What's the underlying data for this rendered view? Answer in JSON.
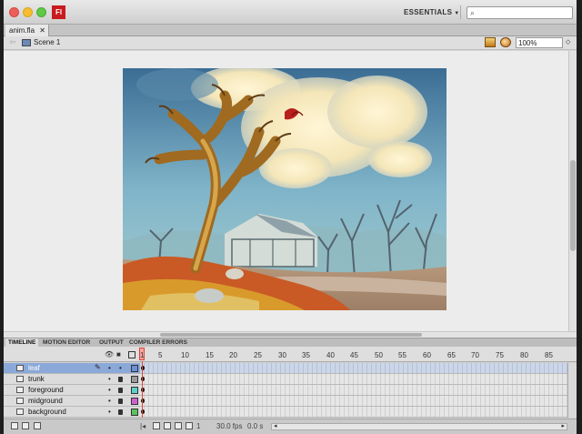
{
  "window": {
    "app_logo": "Fl",
    "workspace_label": "ESSENTIALS",
    "search_placeholder": ""
  },
  "document": {
    "tab_label": "anim.fla",
    "close_glyph": "✕",
    "scene_label": "Scene 1",
    "zoom_value": "100%"
  },
  "panel_tabs": [
    "TIMELINE",
    "MOTION EDITOR",
    "OUTPUT",
    "COMPILER ERRORS"
  ],
  "timeline": {
    "ruler": [
      "1",
      "5",
      "10",
      "15",
      "20",
      "25",
      "30",
      "35",
      "40",
      "45",
      "50",
      "55",
      "60",
      "65",
      "70",
      "75",
      "80",
      "85"
    ],
    "layers": [
      {
        "name": "leaf",
        "selected": true,
        "color": "#6b8fd8"
      },
      {
        "name": "trunk",
        "selected": false,
        "color": "#9a9a9a"
      },
      {
        "name": "foreground",
        "selected": false,
        "color": "#5fcfc8"
      },
      {
        "name": "midground",
        "selected": false,
        "color": "#d060d0"
      },
      {
        "name": "background",
        "selected": false,
        "color": "#5fc060"
      }
    ],
    "current_frame": "1",
    "frame_rate": "30.0 fps",
    "elapsed": "0.0 s"
  },
  "icons": {
    "close": "close-window",
    "minimize": "minimize-window",
    "maximize": "maximize-window",
    "search": "search-icon"
  },
  "colors": {
    "playhead": "#dd4433",
    "selected_layer": "#8aa8d8"
  }
}
